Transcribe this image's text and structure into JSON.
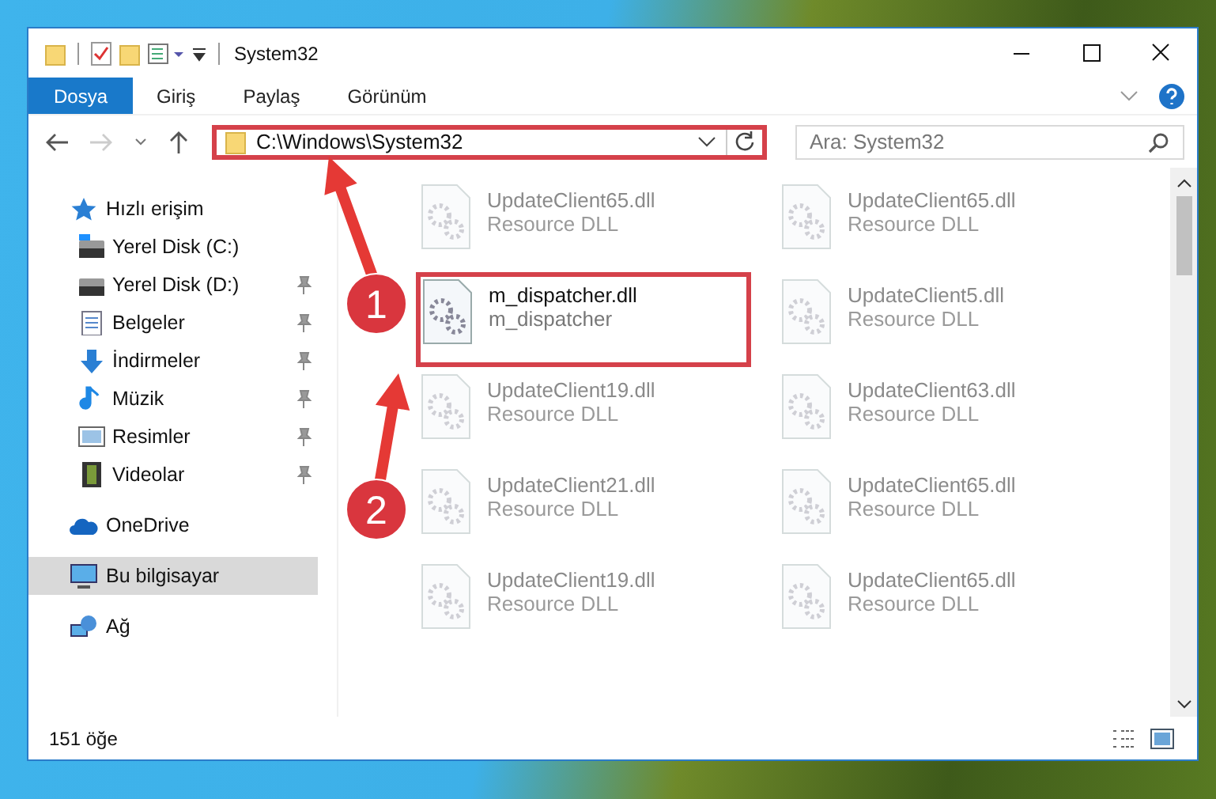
{
  "window": {
    "title": "System32"
  },
  "ribbon_tabs": [
    {
      "label": "Dosya",
      "selected": true
    },
    {
      "label": "Giriş",
      "selected": false
    },
    {
      "label": "Paylaş",
      "selected": false
    },
    {
      "label": "Görünüm",
      "selected": false
    }
  ],
  "address": {
    "path": "C:\\Windows\\System32",
    "highlighted": true
  },
  "search": {
    "placeholder": "Ara: System32"
  },
  "sidebar": [
    {
      "label": "Hızlı erişim",
      "kind": "star",
      "selected": false,
      "children": [
        {
          "label": "Yerel Disk (C:)",
          "kind": "drive",
          "selected": false,
          "pinned": false
        },
        {
          "label": "Yerel Disk (D:)",
          "kind": "drive",
          "selected": false,
          "pinned": true
        },
        {
          "label": "Belgeler",
          "kind": "document",
          "selected": false,
          "pinned": true
        },
        {
          "label": "İndirmeler",
          "kind": "download",
          "selected": false,
          "pinned": true
        },
        {
          "label": "Müzik",
          "kind": "music",
          "selected": false,
          "pinned": true
        },
        {
          "label": "Resimler",
          "kind": "picture",
          "selected": false,
          "pinned": true
        },
        {
          "label": "Videolar",
          "kind": "video",
          "selected": false,
          "pinned": true
        }
      ]
    },
    {
      "label": "OneDrive",
      "kind": "cloud",
      "selected": false
    },
    {
      "label": "Bu bilgisayar",
      "kind": "computer",
      "selected": true
    },
    {
      "label": "Ağ",
      "kind": "network",
      "selected": false
    }
  ],
  "files": [
    {
      "name": "UpdateClient65.dll",
      "type": "Resource DLL",
      "blurred": true,
      "highlighted": false
    },
    {
      "name": "UpdateClient65.dll",
      "type": "Resource DLL",
      "blurred": true,
      "highlighted": false
    },
    {
      "name": "m_dispatcher.dll",
      "type": "m_dispatcher",
      "blurred": false,
      "highlighted": true
    },
    {
      "name": "UpdateClient5.dll",
      "type": "Resource DLL",
      "blurred": true,
      "highlighted": false
    },
    {
      "name": "UpdateClient19.dll",
      "type": "Resource DLL",
      "blurred": true,
      "highlighted": false
    },
    {
      "name": "UpdateClient63.dll",
      "type": "Resource DLL",
      "blurred": true,
      "highlighted": false
    },
    {
      "name": "UpdateClient21.dll",
      "type": "Resource DLL",
      "blurred": true,
      "highlighted": false
    },
    {
      "name": "UpdateClient65.dll",
      "type": "Resource DLL",
      "blurred": true,
      "highlighted": false
    },
    {
      "name": "UpdateClient19.dll",
      "type": "Resource DLL",
      "blurred": true,
      "highlighted": false
    },
    {
      "name": "UpdateClient65.dll",
      "type": "Resource DLL",
      "blurred": true,
      "highlighted": false
    }
  ],
  "callouts": [
    {
      "number": "1"
    },
    {
      "number": "2"
    }
  ],
  "status_bar": {
    "item_count": "151 öğe"
  }
}
